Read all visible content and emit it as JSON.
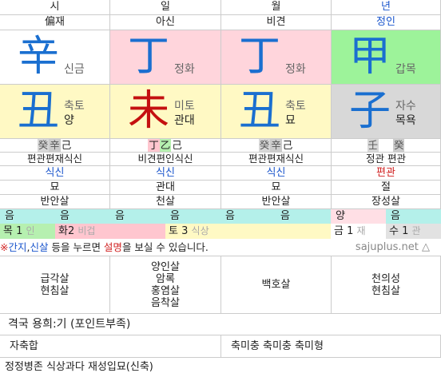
{
  "header": [
    "시",
    "일",
    "월",
    "년"
  ],
  "stem_god": [
    "偏재",
    "아신",
    "비견",
    "정인"
  ],
  "stems": [
    {
      "hanja": "辛",
      "reading": "신금"
    },
    {
      "hanja": "丁",
      "reading": "정화"
    },
    {
      "hanja": "丁",
      "reading": "정화"
    },
    {
      "hanja": "甲",
      "reading": "갑목"
    }
  ],
  "branches": [
    {
      "hanja": "丑",
      "reading": "축토",
      "phase": "양"
    },
    {
      "hanja": "未",
      "reading": "미토",
      "phase": "관대"
    },
    {
      "hanja": "丑",
      "reading": "축토",
      "phase": "묘"
    },
    {
      "hanja": "子",
      "reading": "자수",
      "phase": "목욕"
    }
  ],
  "jijanggan": [
    [
      "癸",
      "辛",
      "己"
    ],
    [
      "丁",
      "乙",
      "己"
    ],
    [
      "癸",
      "辛",
      "己"
    ],
    [
      "壬",
      "",
      "癸"
    ]
  ],
  "jijanggan_gods": [
    "편관편재식신",
    "비견편인식신",
    "편관편재식신",
    "정관 편관"
  ],
  "branch_god": [
    "식신",
    "식신",
    "식신",
    "편관"
  ],
  "twelve_stage": [
    "묘",
    "관대",
    "묘",
    "절"
  ],
  "twelve_sal": [
    "반안살",
    "천살",
    "반안살",
    "장성살"
  ],
  "umyang": [
    "음",
    "음",
    "음",
    "음",
    "음",
    "음",
    "양",
    "음"
  ],
  "ohang": [
    {
      "name": "목",
      "count": "1",
      "sub": "인"
    },
    {
      "name": "화",
      "count": "2",
      "sub": "비겁"
    },
    {
      "name": "토",
      "count": "3",
      "sub": "식상"
    },
    {
      "name": "금",
      "count": "1",
      "sub": "재"
    },
    {
      "name": "수",
      "count": "1",
      "sub": "관"
    }
  ],
  "note": {
    "prefix": "※",
    "k1": "간지",
    "comma": ",",
    "k2": "신살",
    "mid": " 등을 누르면 ",
    "k3": "설명",
    "suffix": "을 보실 수 있습니다.",
    "logo": "sajuplus.net"
  },
  "sinsal": [
    [
      "급각살",
      "현침살"
    ],
    [
      "양인살",
      "암록",
      "홍염살",
      "음착살"
    ],
    [
      "백호살"
    ],
    [
      "천의성",
      "현침살"
    ]
  ],
  "gyeokguk": "격국  용희:기  (포인트부족)",
  "hapchung_left": "자축합",
  "hapchung_right": "축미충 축미충 축미형",
  "summary": "정정병존 식상과다  재성입묘(신축)",
  "colors": {
    "yellow": "#fff9c4",
    "pink": "#ffd5dc",
    "green": "#9df39a",
    "gray": "#d8d8d8",
    "blue_text": "#1a55cc",
    "red_text": "#d02020"
  }
}
